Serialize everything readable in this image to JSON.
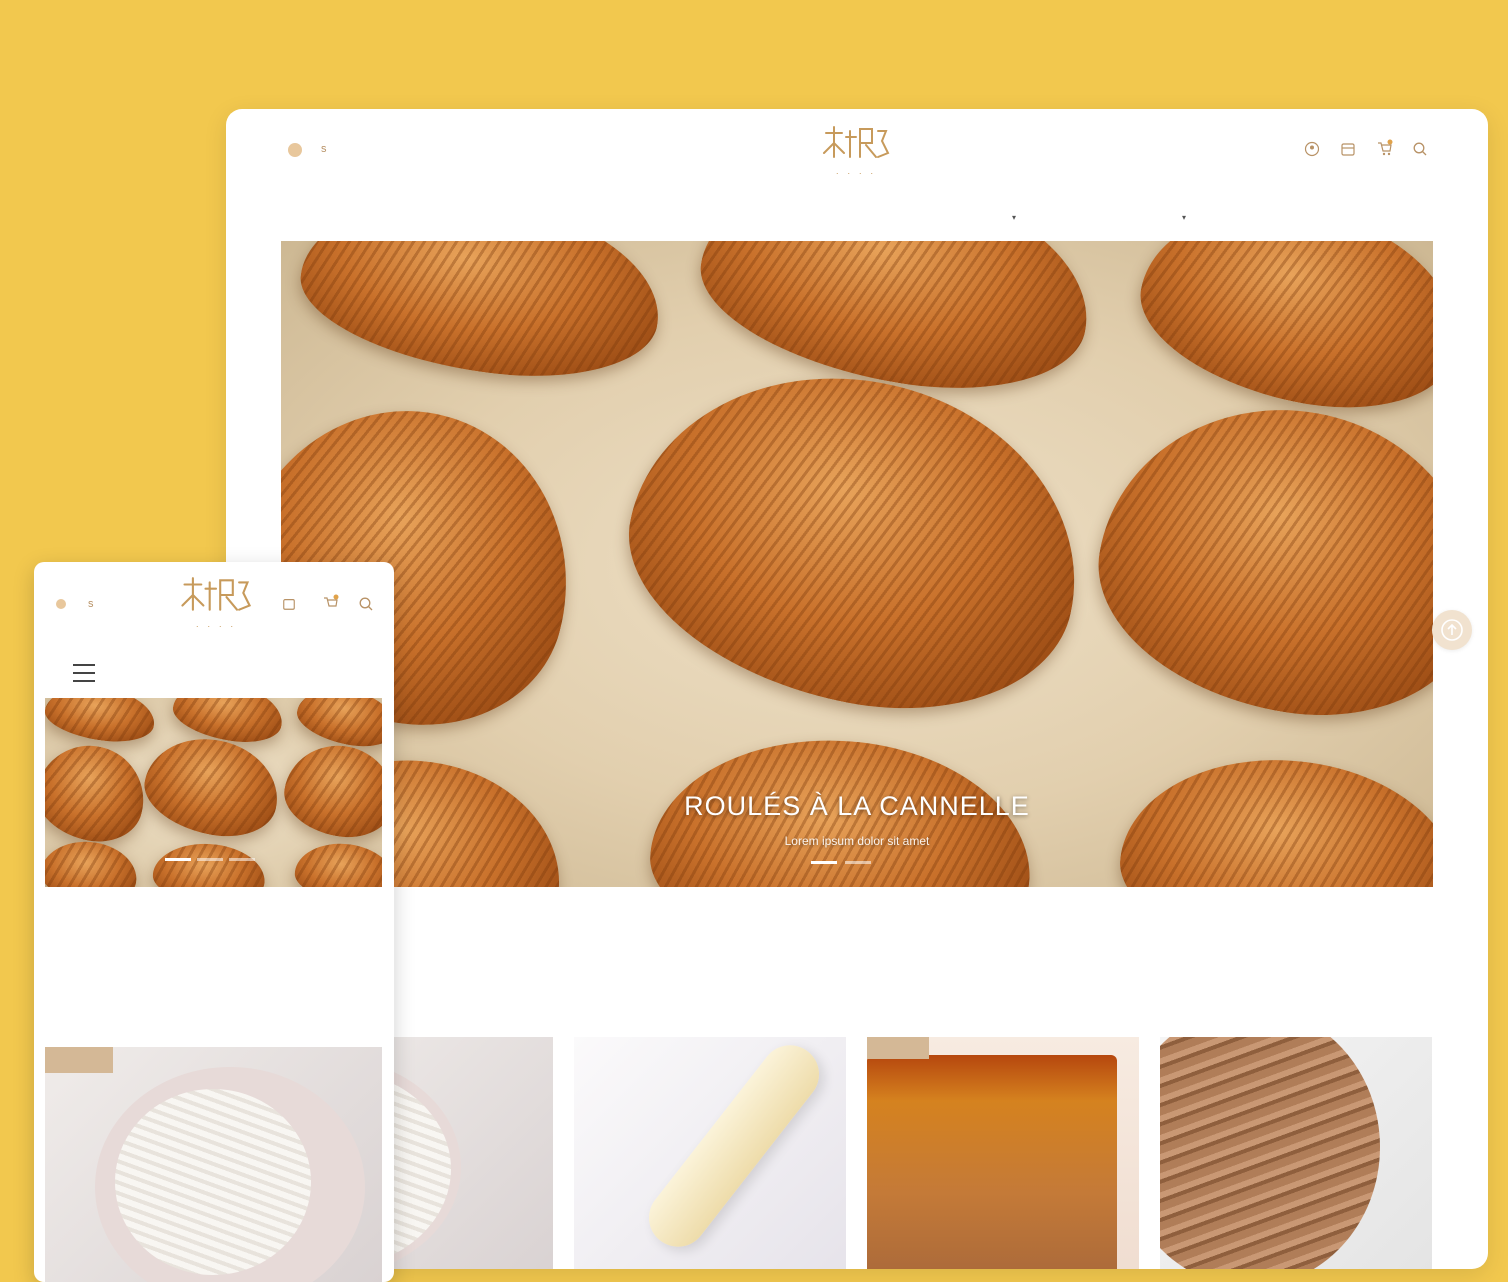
{
  "colors": {
    "background": "#f2c84e",
    "accent_gold": "#c79a5b",
    "badge": "#d4b896",
    "white": "#ffffff"
  },
  "desktop": {
    "header": {
      "lang_label": "s",
      "icons": [
        "account-icon",
        "calendar-icon",
        "cart-icon",
        "search-icon"
      ]
    },
    "nav": [
      {
        "label": "",
        "has_caret": false
      },
      {
        "label": "",
        "has_caret": false
      },
      {
        "label": "",
        "has_caret": false
      },
      {
        "label": "",
        "has_caret": false
      },
      {
        "label": "",
        "has_caret": true
      },
      {
        "label": "",
        "has_caret": true
      },
      {
        "label": "",
        "has_caret": false
      }
    ],
    "hero": {
      "title": "ROULÉS À LA CANNELLE",
      "subtitle": "Lorem ipsum dolor sit amet",
      "slides": 2,
      "active_slide": 1
    },
    "section_title": "",
    "products": [
      {
        "name": "cream-cake",
        "badge": false
      },
      {
        "name": "white-eclair",
        "badge": false
      },
      {
        "name": "creme-brulee-bar",
        "badge": true
      },
      {
        "name": "pastry-puff",
        "badge": false
      }
    ]
  },
  "mobile": {
    "header": {
      "lang_label": "s",
      "icons": [
        "account-icon",
        "cart-icon",
        "search-icon"
      ]
    },
    "section_title": "",
    "products": [
      {
        "name": "cream-cake",
        "badge": true
      }
    ]
  }
}
